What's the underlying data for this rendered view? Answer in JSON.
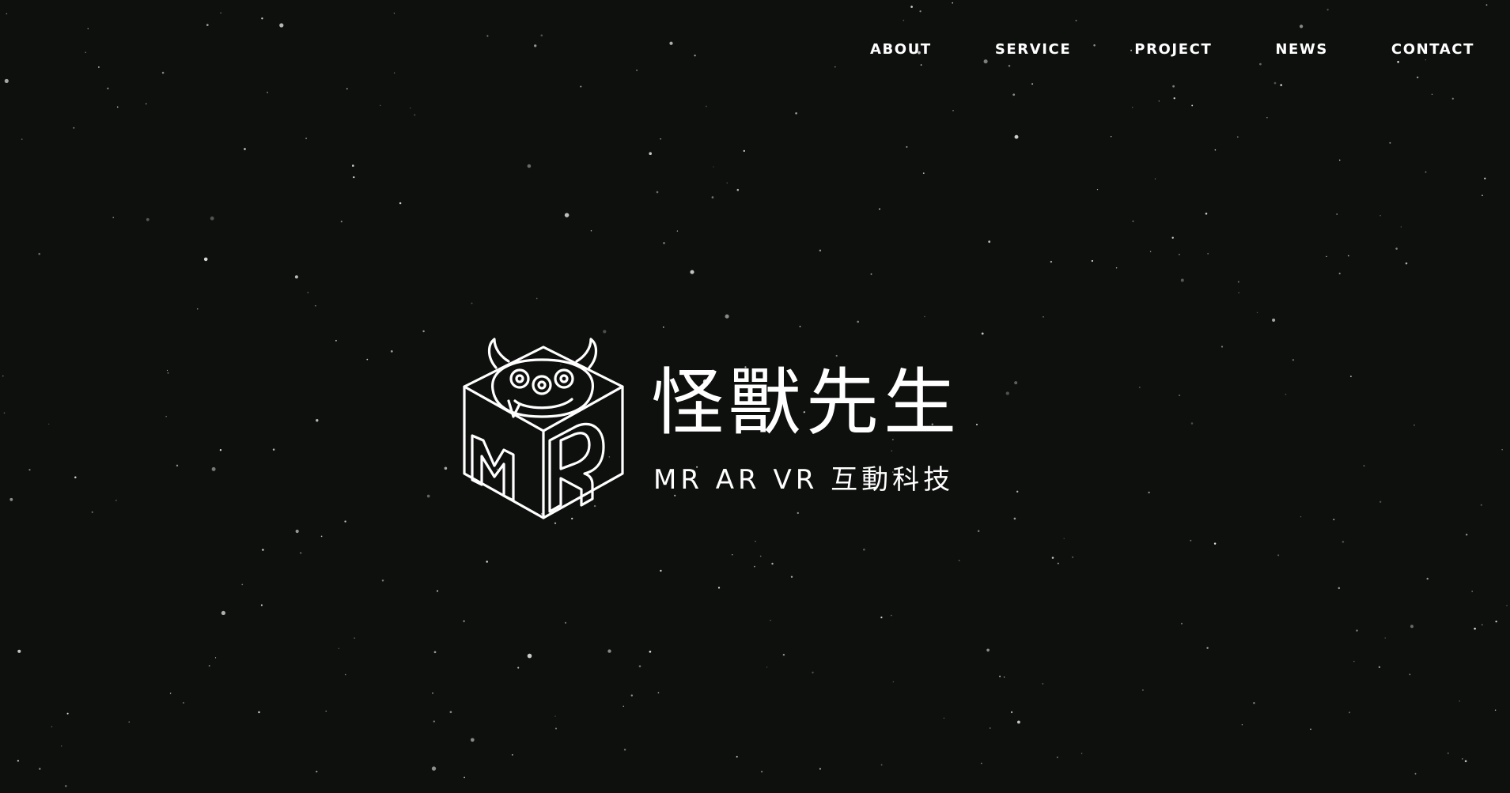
{
  "nav": {
    "items": [
      {
        "label": "ABOUT"
      },
      {
        "label": "SERVICE"
      },
      {
        "label": "PROJECT"
      },
      {
        "label": "NEWS"
      },
      {
        "label": "CONTACT"
      }
    ]
  },
  "hero": {
    "logo_icon": "monster-cube-mr-icon",
    "brand_name": "怪獸先生",
    "tagline": "MR AR VR 互動科技"
  },
  "colors": {
    "background": "#0e100e",
    "text": "#ffffff",
    "stars": "#ffffff"
  }
}
